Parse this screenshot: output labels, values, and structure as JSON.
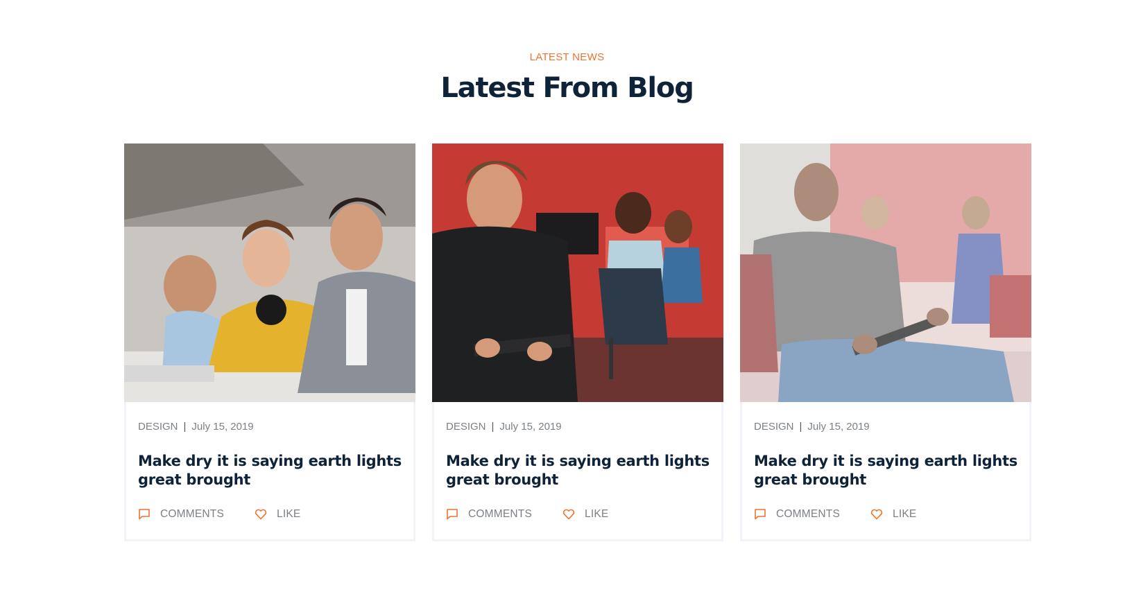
{
  "section": {
    "eyebrow": "LATEST NEWS",
    "title": "Latest From Blog"
  },
  "colors": {
    "accent": "#f0712c",
    "heading": "#0e2338",
    "muted": "#7b7f86",
    "card_border": "#f1f3f8"
  },
  "posts": [
    {
      "category": "DESIGN",
      "date": "July 15, 2019",
      "title": "Make dry it is saying earth lights great brought",
      "comments_label": "COMMENTS",
      "like_label": "LIKE",
      "image": "team-working-at-laptop-photo"
    },
    {
      "category": "DESIGN",
      "date": "July 15, 2019",
      "title": "Make dry it is saying earth lights great brought",
      "comments_label": "COMMENTS",
      "like_label": "LIKE",
      "image": "man-with-tablet-red-office-photo"
    },
    {
      "category": "DESIGN",
      "date": "July 15, 2019",
      "title": "Make dry it is saying earth lights great brought",
      "comments_label": "COMMENTS",
      "like_label": "LIKE",
      "image": "man-seated-with-tablet-faded-photo"
    }
  ],
  "icons": {
    "comments": "comment-icon",
    "like": "heart-icon"
  }
}
